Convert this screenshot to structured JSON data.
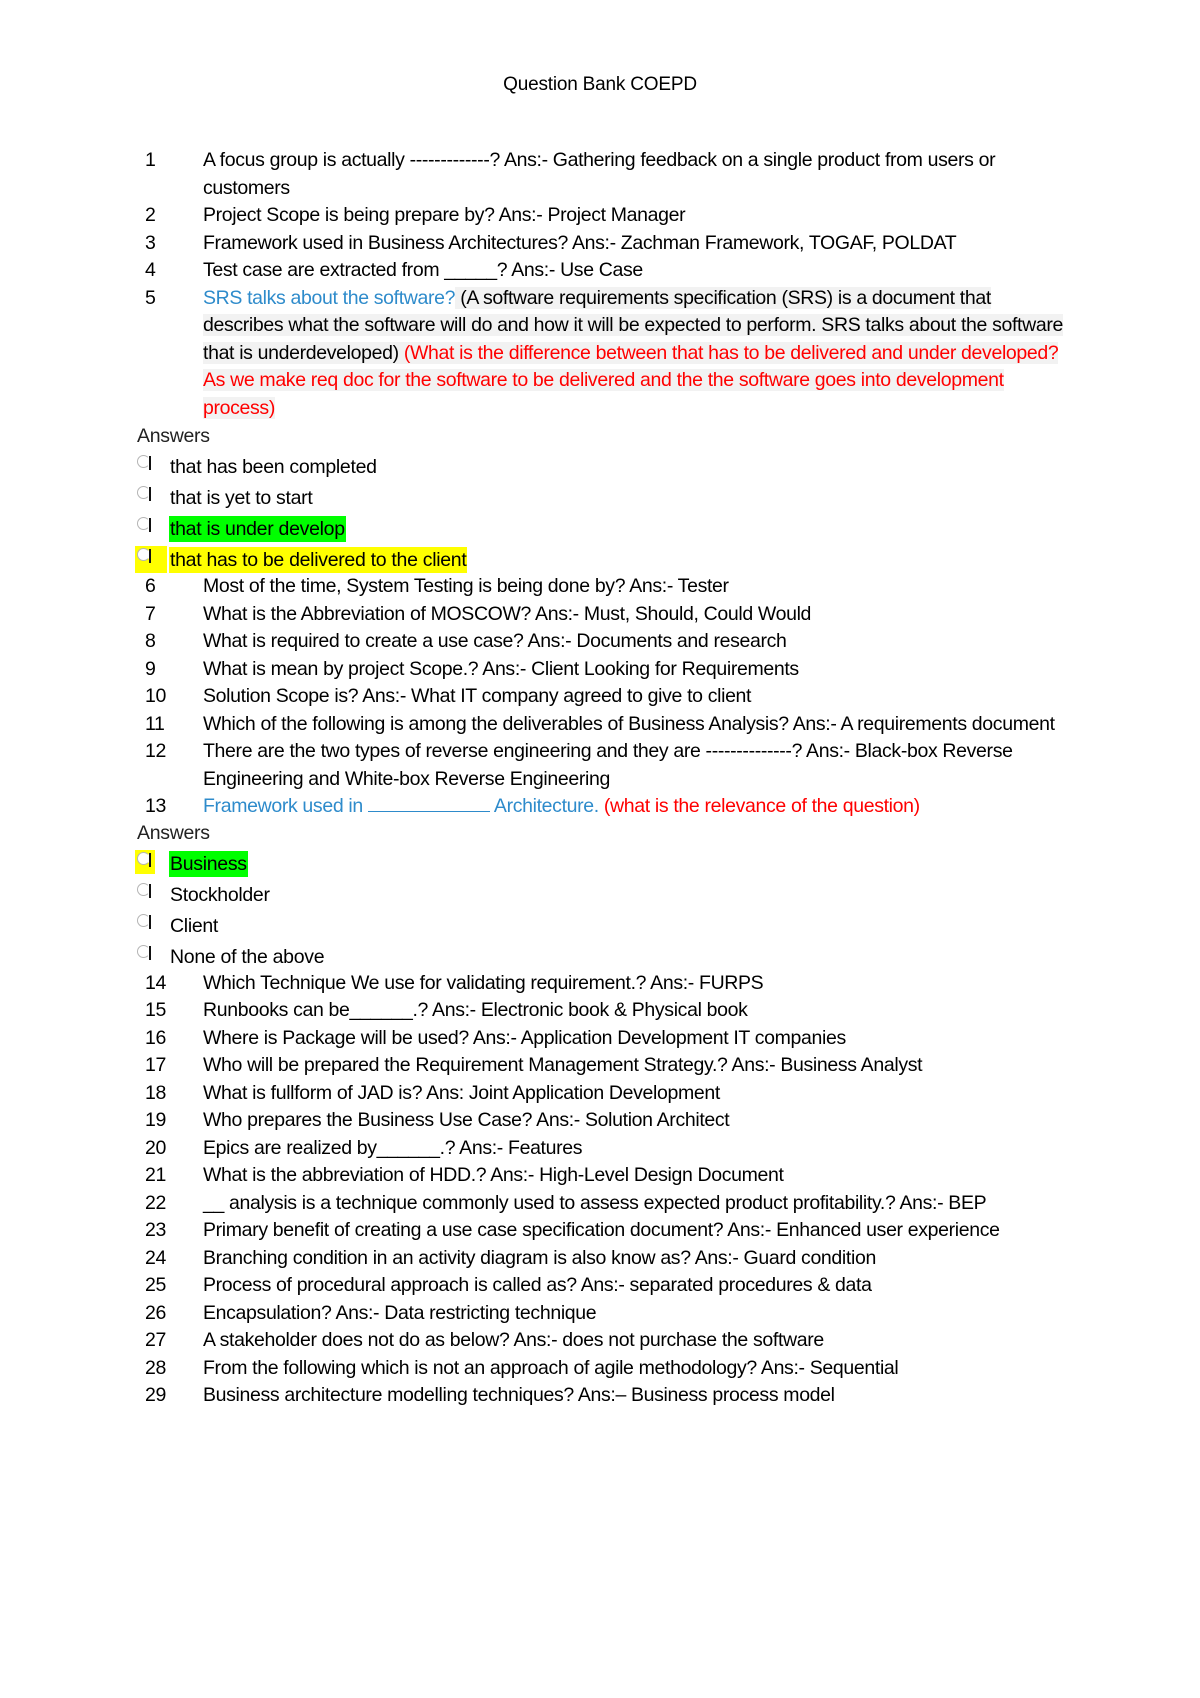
{
  "document": {
    "title": "Question Bank COEPD"
  },
  "colors": {
    "question_blue": "#2e8bcb",
    "note_red": "#ff0000",
    "highlight_green": "#00ff00",
    "highlight_yellow": "#ffff00"
  },
  "questions_a": [
    {
      "num": "1",
      "text": "A focus group is actually -------------? Ans:- Gathering feedback on a single product from users or customers"
    },
    {
      "num": "2",
      "text": "Project Scope is being prepare by? Ans:- Project Manager"
    },
    {
      "num": "3",
      "text": "Framework used in Business Architectures? Ans:- Zachman Framework, TOGAF, POLDAT"
    },
    {
      "num": "4",
      "text": "Test case are extracted from _____? Ans:- Use Case"
    }
  ],
  "q5": {
    "num": "5",
    "question": "SRS talks about the software?",
    "explanation": " (A software requirements specification (SRS) is a document that describes what the software will do and how it will be expected to perform. SRS talks about the software that is underdeveloped)",
    "note": " (What is the difference between that has to be delivered and under developed? As we make req doc for the software to be delivered and the the software goes into development process)",
    "answers_label": "Answers",
    "options": [
      {
        "label": "that has been completed",
        "icon": "radio-icon",
        "highlight": "none"
      },
      {
        "label": "that is yet to start",
        "icon": "radio-icon",
        "highlight": "none"
      },
      {
        "label": "that is under develop",
        "icon": "radio-icon",
        "highlight": "green"
      },
      {
        "label": "that has to be delivered to the client",
        "icon": "radio-icon",
        "highlight": "yellow"
      }
    ]
  },
  "questions_b": [
    {
      "num": "6",
      "text": "Most of the time, System Testing is being done by? Ans:- Tester"
    },
    {
      "num": "7",
      "text": "What is the Abbreviation of MOSCOW? Ans:- Must, Should, Could Would"
    },
    {
      "num": "8",
      "text": "What is required to create a use case? Ans:- Documents and research"
    },
    {
      "num": "9",
      "text": "What is mean by project Scope.? Ans:- Client Looking for Requirements"
    },
    {
      "num": "10",
      "text": "Solution Scope is? Ans:- What IT company agreed to give to client"
    },
    {
      "num": "11",
      "text": "Which of the following is among the deliverables of Business Analysis? Ans:- A requirements document"
    },
    {
      "num": "12",
      "text": "There are the two types of reverse engineering and they are --------------? Ans:- Black-box Reverse Engineering and White-box Reverse Engineering"
    }
  ],
  "q13": {
    "num": "13",
    "question_before_blank": "Framework used in ",
    "question_after_blank": " Architecture.",
    "note": " (what is the relevance of the question)",
    "answers_label": "Answers",
    "options": [
      {
        "label": "Business",
        "icon": "radio-icon",
        "highlight": "green",
        "radio_highlight": "yellow"
      },
      {
        "label": "Stockholder",
        "icon": "radio-icon",
        "highlight": "none"
      },
      {
        "label": "Client",
        "icon": "radio-icon",
        "highlight": "none"
      },
      {
        "label": "None of the above",
        "icon": "radio-icon",
        "highlight": "none"
      }
    ]
  },
  "questions_c": [
    {
      "num": "14",
      "text": "Which Technique We use for validating requirement.? Ans:- FURPS"
    },
    {
      "num": "15",
      "text": "Runbooks can be______.? Ans:- Electronic book & Physical book"
    },
    {
      "num": "16",
      "text": "Where is Package will be used? Ans:- Application Development IT companies"
    },
    {
      "num": "17",
      "text": "Who will be prepared the Requirement Management Strategy.? Ans:- Business Analyst"
    },
    {
      "num": "18",
      "text": "What is fullform of JAD is? Ans: Joint Application Development"
    },
    {
      "num": "19",
      "text": "Who prepares the Business Use Case? Ans:- Solution Architect"
    },
    {
      "num": "20",
      "text": "Epics are realized by______.? Ans:- Features"
    },
    {
      "num": "21",
      "text": "What is the abbreviation of HDD.? Ans:- High-Level Design Document"
    },
    {
      "num": "22",
      "text": "__ analysis is a technique commonly used to assess expected product profitability.? Ans:- BEP"
    },
    {
      "num": "23",
      "text": "Primary benefit of creating a use case specification document? Ans:- Enhanced user experience"
    },
    {
      "num": "24",
      "text": "Branching condition in an activity diagram is also know as? Ans:- Guard condition"
    },
    {
      "num": "25",
      "text": "Process of procedural approach is called as? Ans:- separated procedures & data"
    },
    {
      "num": "26",
      "text": "Encapsulation? Ans:- Data restricting technique"
    },
    {
      "num": "27",
      "text": "A stakeholder does not do as below? Ans:- does not purchase the software"
    },
    {
      "num": "28",
      "text": "From the following which is not an approach of agile methodology? Ans:- Sequential"
    },
    {
      "num": "29",
      "text": "Business architecture modelling techniques? Ans:– Business process model"
    }
  ]
}
